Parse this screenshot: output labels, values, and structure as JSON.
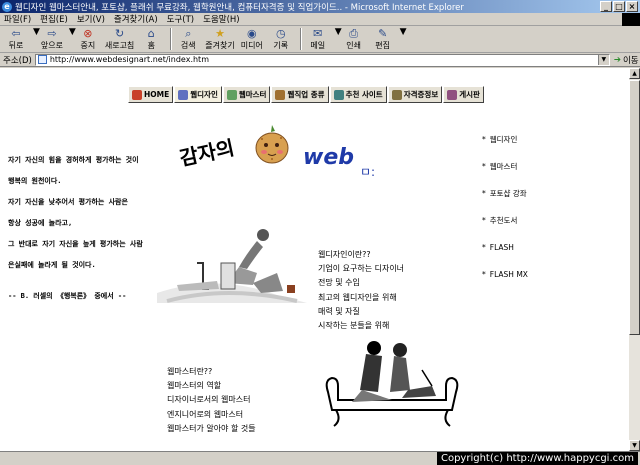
{
  "window": {
    "title": "웹디자인 웹마스터안내, 포토샵, 플래쉬 무료강좌, 웹학원안내, 컴퓨터자격증 및 직업가이드.. - Microsoft Internet Explorer",
    "minimize": "_",
    "maximize": "□",
    "close": "×"
  },
  "menu": [
    "파일(F)",
    "편집(E)",
    "보기(V)",
    "즐겨찾기(A)",
    "도구(T)",
    "도움말(H)"
  ],
  "toolbar": {
    "back": "뒤로",
    "forward": "앞으로",
    "stop": "중지",
    "refresh": "새로고침",
    "home": "홈",
    "search": "검색",
    "favorites": "즐겨찾기",
    "media": "미디어",
    "history": "기록",
    "mail": "메일",
    "print": "인쇄",
    "edit": "편집"
  },
  "address": {
    "label": "주소(D)",
    "url": "http://www.webdesignart.net/index.htm",
    "go": "이동"
  },
  "nav": [
    "HOME",
    "웹디자인",
    "웹마스터",
    "웹직업 종류",
    "추천 사이트",
    "자격증정보",
    "게시판"
  ],
  "quote": {
    "lines": [
      "자기 자신의 힘을 경허하게 평가하는 것이",
      "행복의 원천이다.",
      "자기 자신을 낮추어서 평가하는 사람은",
      "항상 성공에 놀라고,",
      "그 반대로 자기 자신을 높게 평가하는 사람",
      "은실패에 놀라게 될 것이다."
    ],
    "author": "-- B. 러셀의 《행복론》 중에서 --"
  },
  "logo": {
    "korean": "감자의",
    "web": "web",
    "dots": "ㅁ:"
  },
  "designer_list": [
    "웹디자인이란??",
    "기업이 요구하는 디자이너",
    "전망 및 수입",
    "최고의 웹디자인을 위해",
    "매력 및 자질",
    "시작하는 분들을 위해"
  ],
  "master_list": [
    "웹마스터란??",
    "웹마스터의 역할",
    "디자이너로서의 웹마스터",
    "엔지니어로의 웹마스터",
    "웹마스터가 알아야 할 것들"
  ],
  "side_nav": [
    "웹디자인",
    "웹마스터",
    "포토샵 강좌",
    "추천도서",
    "FLASH",
    "FLASH MX"
  ],
  "side_star": "*",
  "copyright": "Copyright(c) http://www.happycgi.com",
  "colors": {
    "title_start": "#0a246a",
    "logo_blue": "#1f3aa8",
    "chrome": "#d4d0c8"
  }
}
